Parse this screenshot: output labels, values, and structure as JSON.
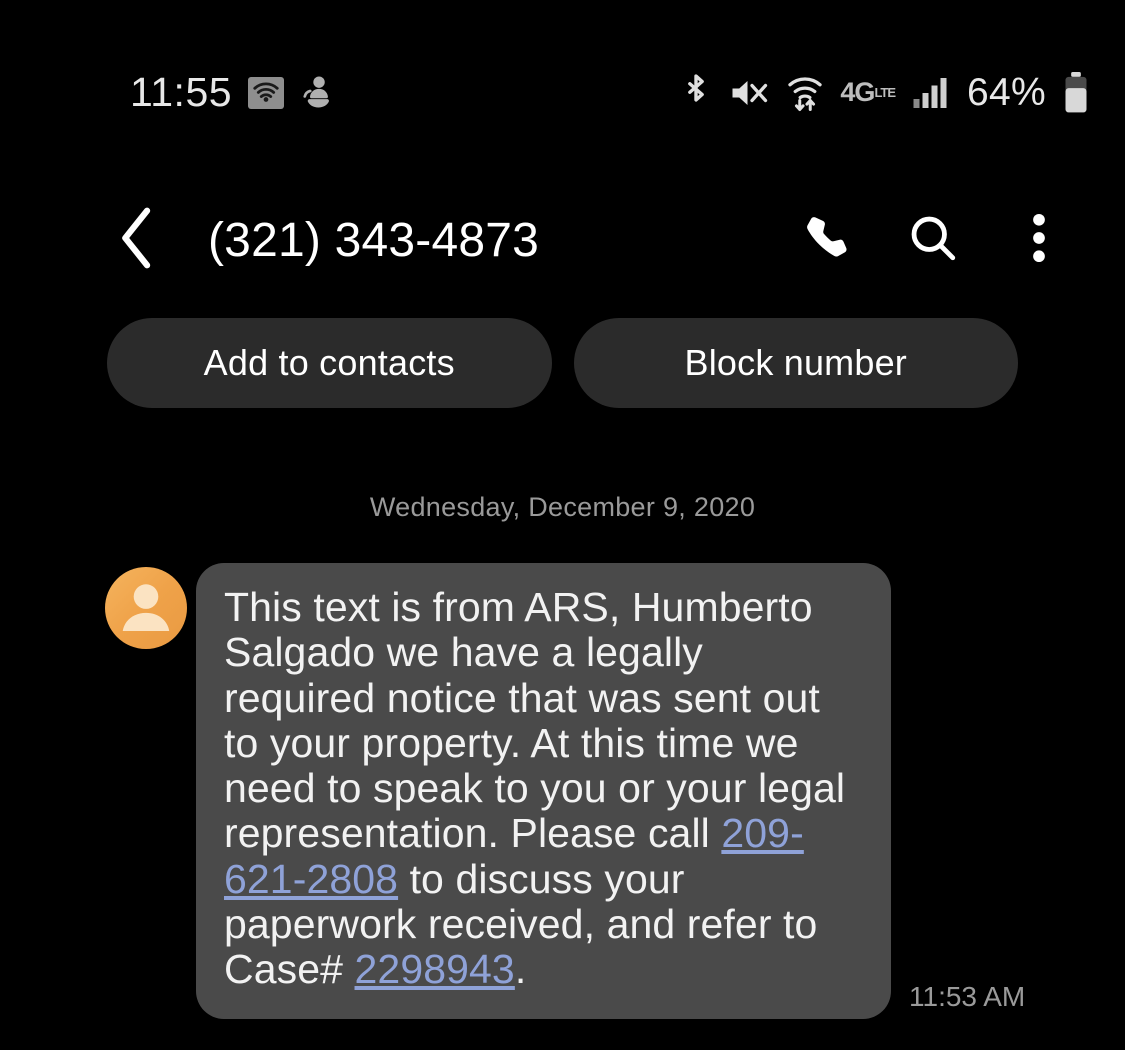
{
  "status_bar": {
    "clock": "11:55",
    "battery_percent": "64%",
    "lte_label": "4G",
    "icons": {
      "wifi_calling": "wifi-calling-icon",
      "app_notification": "app-notification-icon",
      "bluetooth": "bluetooth-icon",
      "mute": "volume-mute-icon",
      "wifi_data": "wifi-data-transfer-icon",
      "signal": "cellular-signal-icon",
      "battery": "battery-icon"
    }
  },
  "header": {
    "title": "(321) 343-4873",
    "back_icon": "chevron-left-icon",
    "call_icon": "phone-icon",
    "search_icon": "search-icon",
    "more_icon": "overflow-menu-icon"
  },
  "actions": {
    "add_to_contacts_label": "Add to contacts",
    "block_number_label": "Block number"
  },
  "conversation": {
    "date_divider": "Wednesday, December 9, 2020",
    "message": {
      "sender_avatar": "contact-avatar",
      "text_part_1": "This text is from ARS, Humberto Salgado we have a legally required notice that was sent out to your property. At this time we need to speak to you or your legal representation. Please call ",
      "link_phone": "209-621-2808",
      "text_part_2": " to discuss your paperwork received, and refer to Case# ",
      "link_case": "2298943",
      "text_part_3": ".",
      "timestamp": "11:53 AM"
    }
  },
  "colors": {
    "background": "#000000",
    "pill_bg": "#2b2b2b",
    "bubble_bg": "#4a4a4a",
    "link": "#8fa2d8",
    "avatar_orange": "#efa249",
    "muted_text": "#9a9a9a"
  }
}
